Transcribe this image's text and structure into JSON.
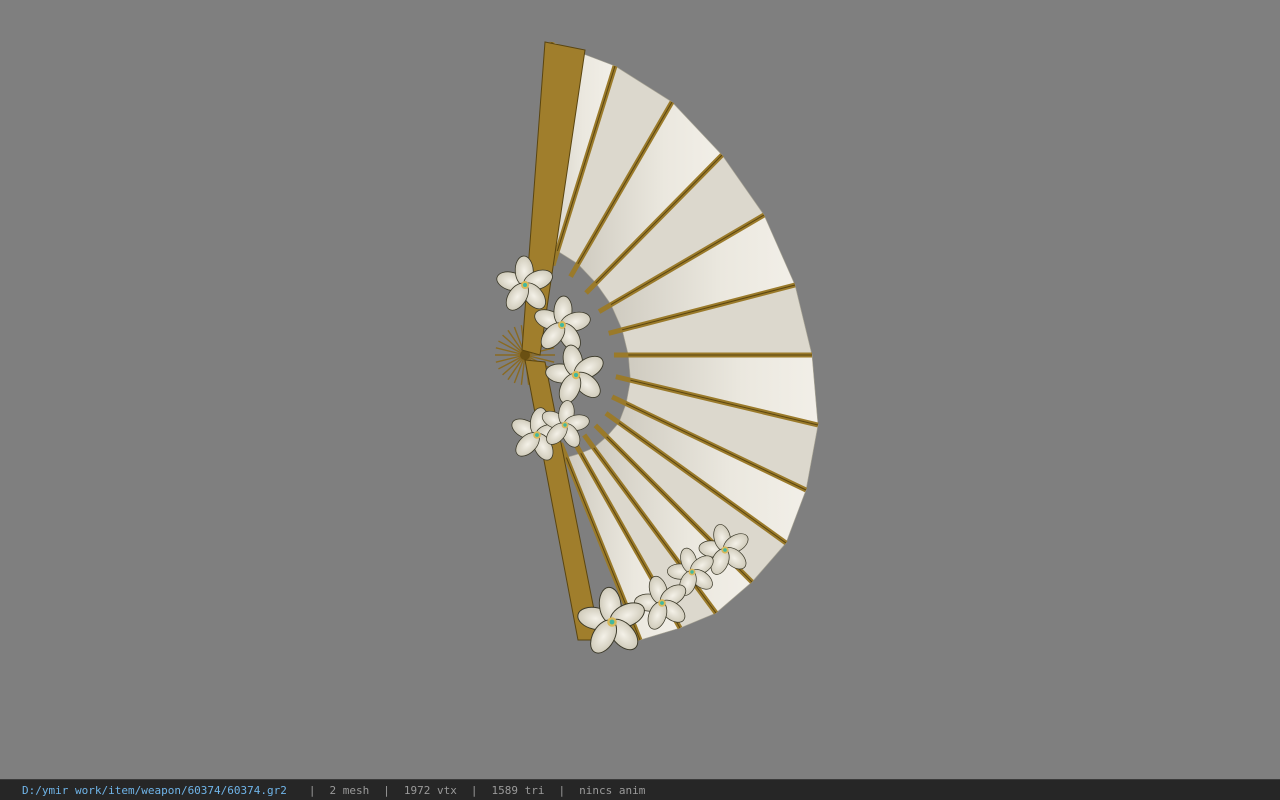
{
  "viewer": {
    "background": "#7f7f7f",
    "model": {
      "name": "folding-fan-with-flowers",
      "rib_color": "#9a7a2a",
      "paper_color": "#e8e4da",
      "flower_color": "#e6e2d6",
      "flower_center_color": "#3fb8a0"
    }
  },
  "status_bar": {
    "file_path": "D:/ymir work/item/weapon/60374/60374.gr2",
    "separator": "|",
    "mesh_count": "2 mesh",
    "vertex_count": "1972 vtx",
    "triangle_count": "1589 tri",
    "anim_status": "nincs anim"
  }
}
